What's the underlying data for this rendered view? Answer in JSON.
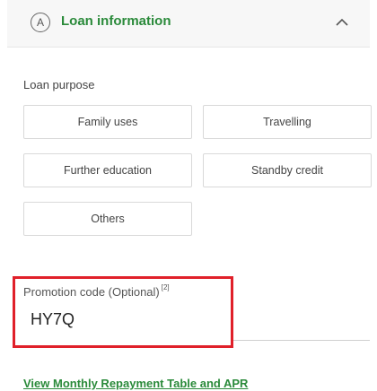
{
  "section": {
    "step_badge": "A",
    "title": "Loan information",
    "collapse_icon": "chevron-up-icon"
  },
  "loan_purpose": {
    "label": "Loan purpose",
    "options": [
      "Family uses",
      "Travelling",
      "Further education",
      "Standby credit",
      "Others"
    ]
  },
  "promotion": {
    "label": "Promotion code (Optional)",
    "footnote": "[2]",
    "value": "HY7Q",
    "highlight_color": "#e0202a"
  },
  "link": {
    "label": "View Monthly Repayment Table and APR"
  },
  "colors": {
    "accent": "#2a8a3a"
  }
}
